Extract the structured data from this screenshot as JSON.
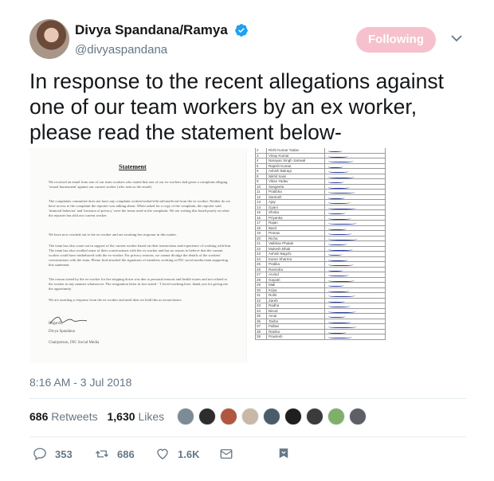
{
  "author": {
    "display_name": "Divya Spandana/Ramya",
    "handle": "@divyaspandana",
    "follow_label": "Following",
    "verified_color": "#1da1f2"
  },
  "tweet": {
    "text": "In response to the recent allegations against one of our team workers by an ex worker, please read the statement below-",
    "timestamp": "8:16 AM - 3 Jul 2018"
  },
  "statement": {
    "title": "Statement",
    "paragraphs": [
      "We received an email from one of our team workers who stated that one of our ex-workers had given a complaint alleging 'sexual harassment' against our current worker (who sent us the email).",
      "The complaints committee does not have any complaint written/verbal/official/unofficial from the ex-worker. Neither do we have access to the complaint the reporter was talking about. When asked for a copy of the complaint, the reporter said 'immoral behavior' and 'invasion of privacy' were the terms used in the complaint. We are writing this based purely on what the reporter has told our current worker.",
      "We have now reached out to the ex-worker and are awaiting her response in this matter.",
      "The team has also come out in support of the current worker based on their interactions and experience of working with him. The team has also recalled some of their conversations with the ex-worker and has no reason to believe that the current worker could have misbehaved with the ex-worker. For privacy reasons, we cannot divulge the details of the workers' conversations with the team. Please find attached the signatures of members working at INC social media team supporting this statement.",
      "The reason stated by the ex-worker for her stepping down was due to personal reasons and health issues and not related to the worker in any manner whatsoever. The resignation letter in fact stated - 'I loved working here, thank you for giving me the opportunity.'",
      "We are awaiting a response from the ex-worker and until then we hold this as inconclusive."
    ],
    "regards": "Regards,",
    "signatory": "Divya Spandana",
    "role": "Chairperson, INC Social Media"
  },
  "signatures": {
    "rows": [
      {
        "num": "2",
        "name": "Rishi Kumar Yadav"
      },
      {
        "num": "3",
        "name": "Vinay Kumar"
      },
      {
        "num": "4",
        "name": "Narayan Singh Jamwal"
      },
      {
        "num": "5",
        "name": "Rajesh Kumar"
      },
      {
        "num": "6",
        "name": "Ashish Bairagi"
      },
      {
        "num": "8",
        "name": "Nikhil Saini"
      },
      {
        "num": "9",
        "name": "Vikas Yadav"
      },
      {
        "num": "10",
        "name": "Sangeeta"
      },
      {
        "num": "11",
        "name": "Pratibha"
      },
      {
        "num": "12",
        "name": "Santosh"
      },
      {
        "num": "13",
        "name": "Ajay"
      },
      {
        "num": "14",
        "name": "Gyani"
      },
      {
        "num": "15",
        "name": "Shoba"
      },
      {
        "num": "16",
        "name": "Priyanka"
      },
      {
        "num": "17",
        "name": "Rajan"
      },
      {
        "num": "18",
        "name": "Basil"
      },
      {
        "num": "19",
        "name": "Pranav"
      },
      {
        "num": "20",
        "name": "Richa"
      },
      {
        "num": "21",
        "name": "Vaibhav Phatak"
      },
      {
        "num": "22",
        "name": "Mukesh Bhati"
      },
      {
        "num": "23",
        "name": "Ashish Bagchi"
      },
      {
        "num": "24",
        "name": "Karan Sharma"
      },
      {
        "num": "25",
        "name": "Pratika"
      },
      {
        "num": "26",
        "name": "Ravindra"
      },
      {
        "num": "27",
        "name": "Arvind"
      },
      {
        "num": "28",
        "name": "Gayatri"
      },
      {
        "num": "29",
        "name": "Mali"
      },
      {
        "num": "30",
        "name": "Kripa"
      },
      {
        "num": "31",
        "name": "Rohit"
      },
      {
        "num": "32",
        "name": "Zareb"
      },
      {
        "num": "33",
        "name": "Radha"
      },
      {
        "num": "34",
        "name": "Binod"
      },
      {
        "num": "35",
        "name": "Amar"
      },
      {
        "num": "36",
        "name": "Tasha"
      },
      {
        "num": "37",
        "name": "Pallavi"
      },
      {
        "num": "38",
        "name": "Ranika"
      },
      {
        "num": "39",
        "name": "Pravlesh"
      }
    ]
  },
  "engagement": {
    "retweets_count": "686",
    "retweets_label": "Retweets",
    "likes_count": "1,630",
    "likes_label": "Likes",
    "liker_avatar_colors": [
      "#7d8b95",
      "#2d2d2d",
      "#b1563f",
      "#c9b8a6",
      "#4a5c6a",
      "#1f1f1f",
      "#3b3b3b",
      "#7fb069",
      "#5e5e66"
    ]
  },
  "actions": {
    "reply_count": "353",
    "retweet_count": "686",
    "like_count": "1.6K",
    "accent_color": "#657786"
  }
}
